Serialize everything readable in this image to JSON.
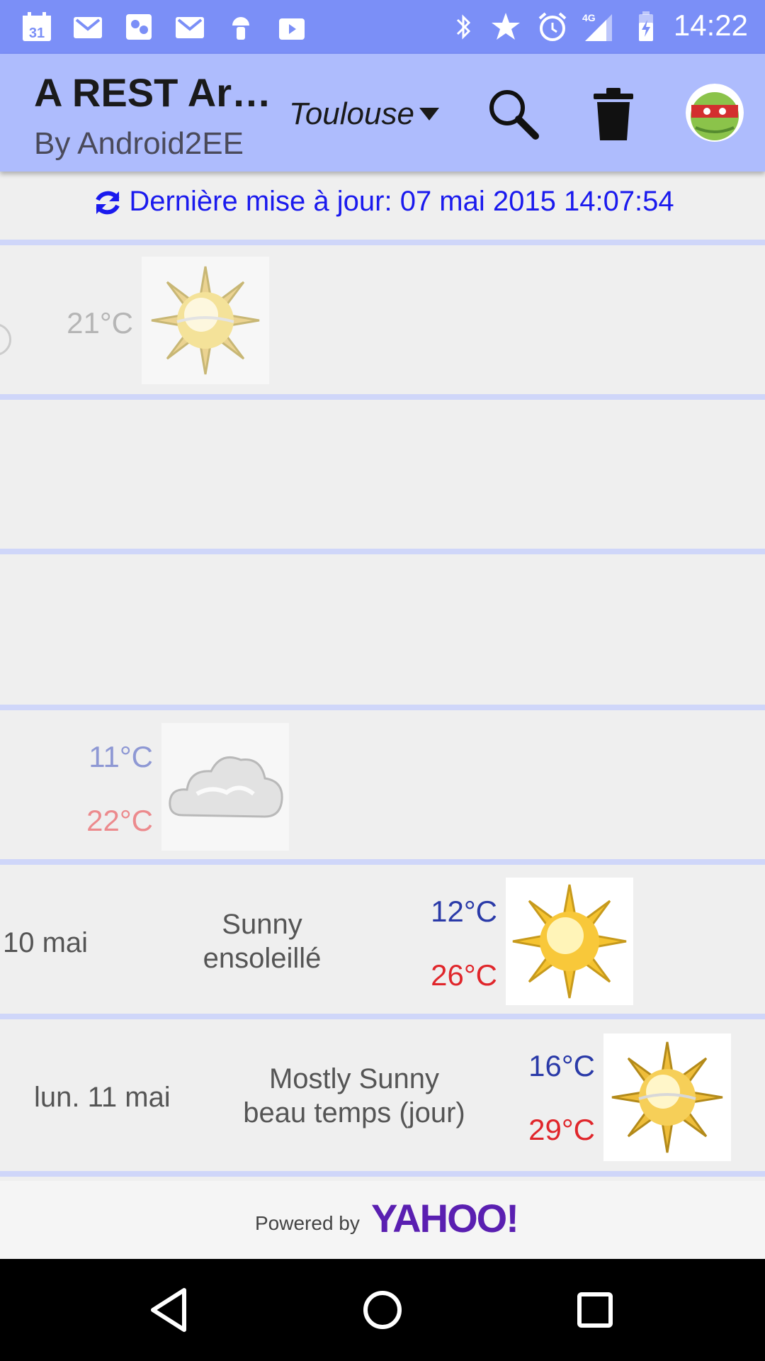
{
  "statusbar": {
    "time": "14:22",
    "network": "4G",
    "calendar_day": "31"
  },
  "appbar": {
    "title": "A REST Ar…",
    "subtitle": "By Android2EE",
    "city": "Toulouse"
  },
  "last_update": "Dernière mise à jour: 07 mai 2015 14:07:54",
  "rows": [
    {
      "temp_low": "21°C",
      "icon": "sun-icon"
    },
    {},
    {},
    {
      "temp_low": "11°C",
      "temp_high": "22°C",
      "icon": "cloud-icon"
    },
    {
      "date": "10 mai",
      "desc_en": "Sunny",
      "desc_fr": "ensoleillé",
      "temp_low": "12°C",
      "temp_high": "26°C",
      "icon": "sun-icon"
    },
    {
      "date": "lun. 11 mai",
      "desc_en": "Mostly Sunny",
      "desc_fr": "beau temps (jour)",
      "temp_low": "16°C",
      "temp_high": "29°C",
      "icon": "sun-icon"
    }
  ],
  "footer": {
    "powered": "Powered by",
    "brand": "YAHOO!"
  },
  "colors": {
    "statusbar": "#7b8ff7",
    "appbar": "#aebcfd",
    "separator": "#cfd6f9",
    "temp_low": "#2a3aa8",
    "temp_high": "#e0262b",
    "update_text": "#1a1aee"
  }
}
